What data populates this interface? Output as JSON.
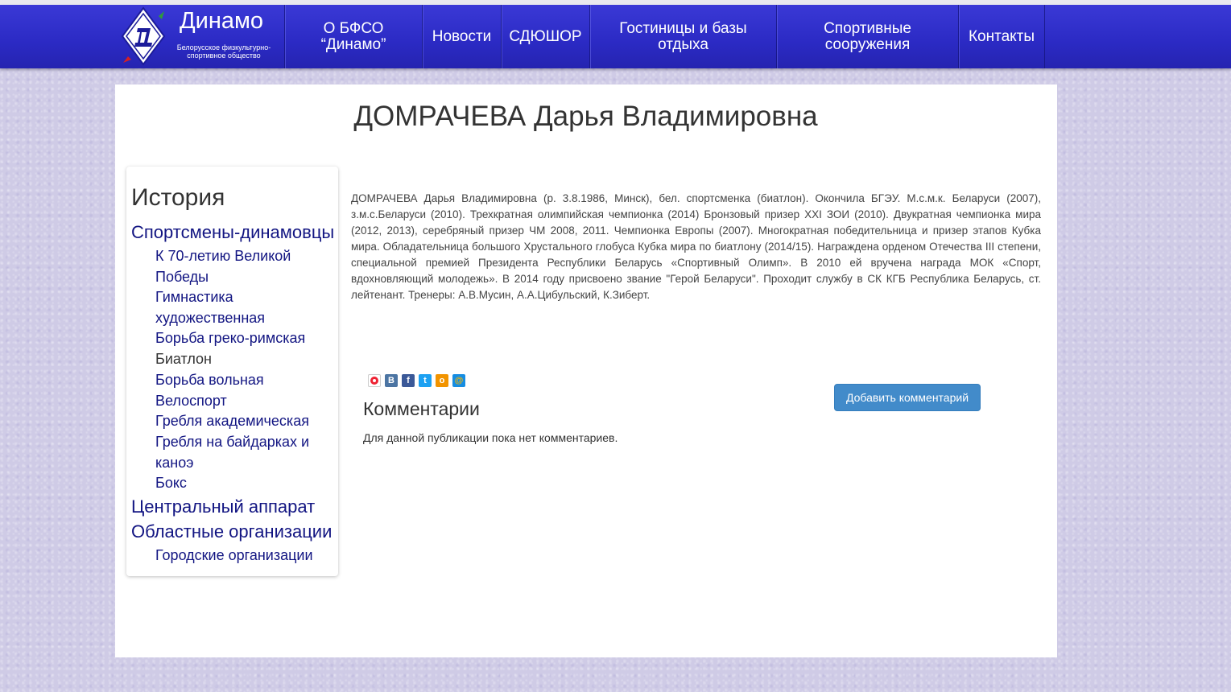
{
  "brand": {
    "name": "Динамо",
    "subtitle": "Белорусское физкультурно-спортивное общество"
  },
  "nav": {
    "items": [
      {
        "label": "О БФСО\n“Динамо”"
      },
      {
        "label": "Новости"
      },
      {
        "label": "СДЮШОР"
      },
      {
        "label": "Гостиницы и базы\nотдыха"
      },
      {
        "label": "Спортивные\nсооружения"
      },
      {
        "label": "Контакты"
      }
    ]
  },
  "page": {
    "title": "ДОМРАЧЕВА Дарья Владимировна"
  },
  "sidebar": {
    "heading": "История",
    "items": [
      {
        "label": "Спортсмены-динамовцы"
      },
      {
        "label": "К 70-летию Великой Победы"
      },
      {
        "label": "Гимнастика художественная"
      },
      {
        "label": "Борьба греко-римская"
      },
      {
        "label": "Биатлон"
      },
      {
        "label": "Борьба вольная"
      },
      {
        "label": "Велоспорт"
      },
      {
        "label": "Гребля академическая"
      },
      {
        "label": "Гребля на байдарках и каноэ"
      },
      {
        "label": "Бокс"
      },
      {
        "label": "Центральный аппарат"
      },
      {
        "label": "Областные организации"
      },
      {
        "label": "Городские организации"
      }
    ]
  },
  "article": {
    "text": "ДОМРАЧЕВА Дарья Владимировна (р. 3.8.1986, Минск), бел. спортсменка (биатлон). Окончила  БГЭУ. М.с.м.к. Беларуси (2007), з.м.с.Беларуси (2010). Трехкратная олимпийская чемпионка (2014) Бронзовый призер XXI ЗОИ (2010). Двукратная чемпионка мира (2012, 2013), серебряный призер ЧМ 2008, 2011. Чемпионка Европы (2007). Многократная победительница и призер этапов Кубка мира. Обладательница большого Хрустального глобуса Кубка мира по биатлону (2014/15). Награждена орденом Отечества III степени, специальной премией Президента Республики Беларусь «Спортивный Олимп». В 2010 ей вручена награда МОК «Спорт, вдохновляющий молодежь». В 2014 году присвоено звание \"Герой Беларуси\". Проходит службу в СК КГБ Республика Беларусь, ст. лейтенант. Тренеры: А.В.Мусин, А.А.Цибульский, К.Зиберт."
  },
  "share": {
    "icons": [
      {
        "name": "yandex-icon",
        "glyph": "",
        "color": "#ffffff"
      },
      {
        "name": "vkontakte-icon",
        "glyph": "В",
        "color": "#4c75a3"
      },
      {
        "name": "facebook-icon",
        "glyph": "f",
        "color": "#3b5998"
      },
      {
        "name": "twitter-icon",
        "glyph": "t",
        "color": "#1da1f2"
      },
      {
        "name": "odnoklassniki-icon",
        "glyph": "о",
        "color": "#f29400"
      },
      {
        "name": "mailru-icon",
        "glyph": "@",
        "color": "#168de2"
      }
    ]
  },
  "comments": {
    "title": "Комментарии",
    "empty_text": "Для данной публикации пока нет комментариев.",
    "add_button_label": "Добавить комментарий"
  },
  "colors": {
    "navbar": "#2b2ac4",
    "sidebar_link": "#121582",
    "button": "#428bca"
  }
}
